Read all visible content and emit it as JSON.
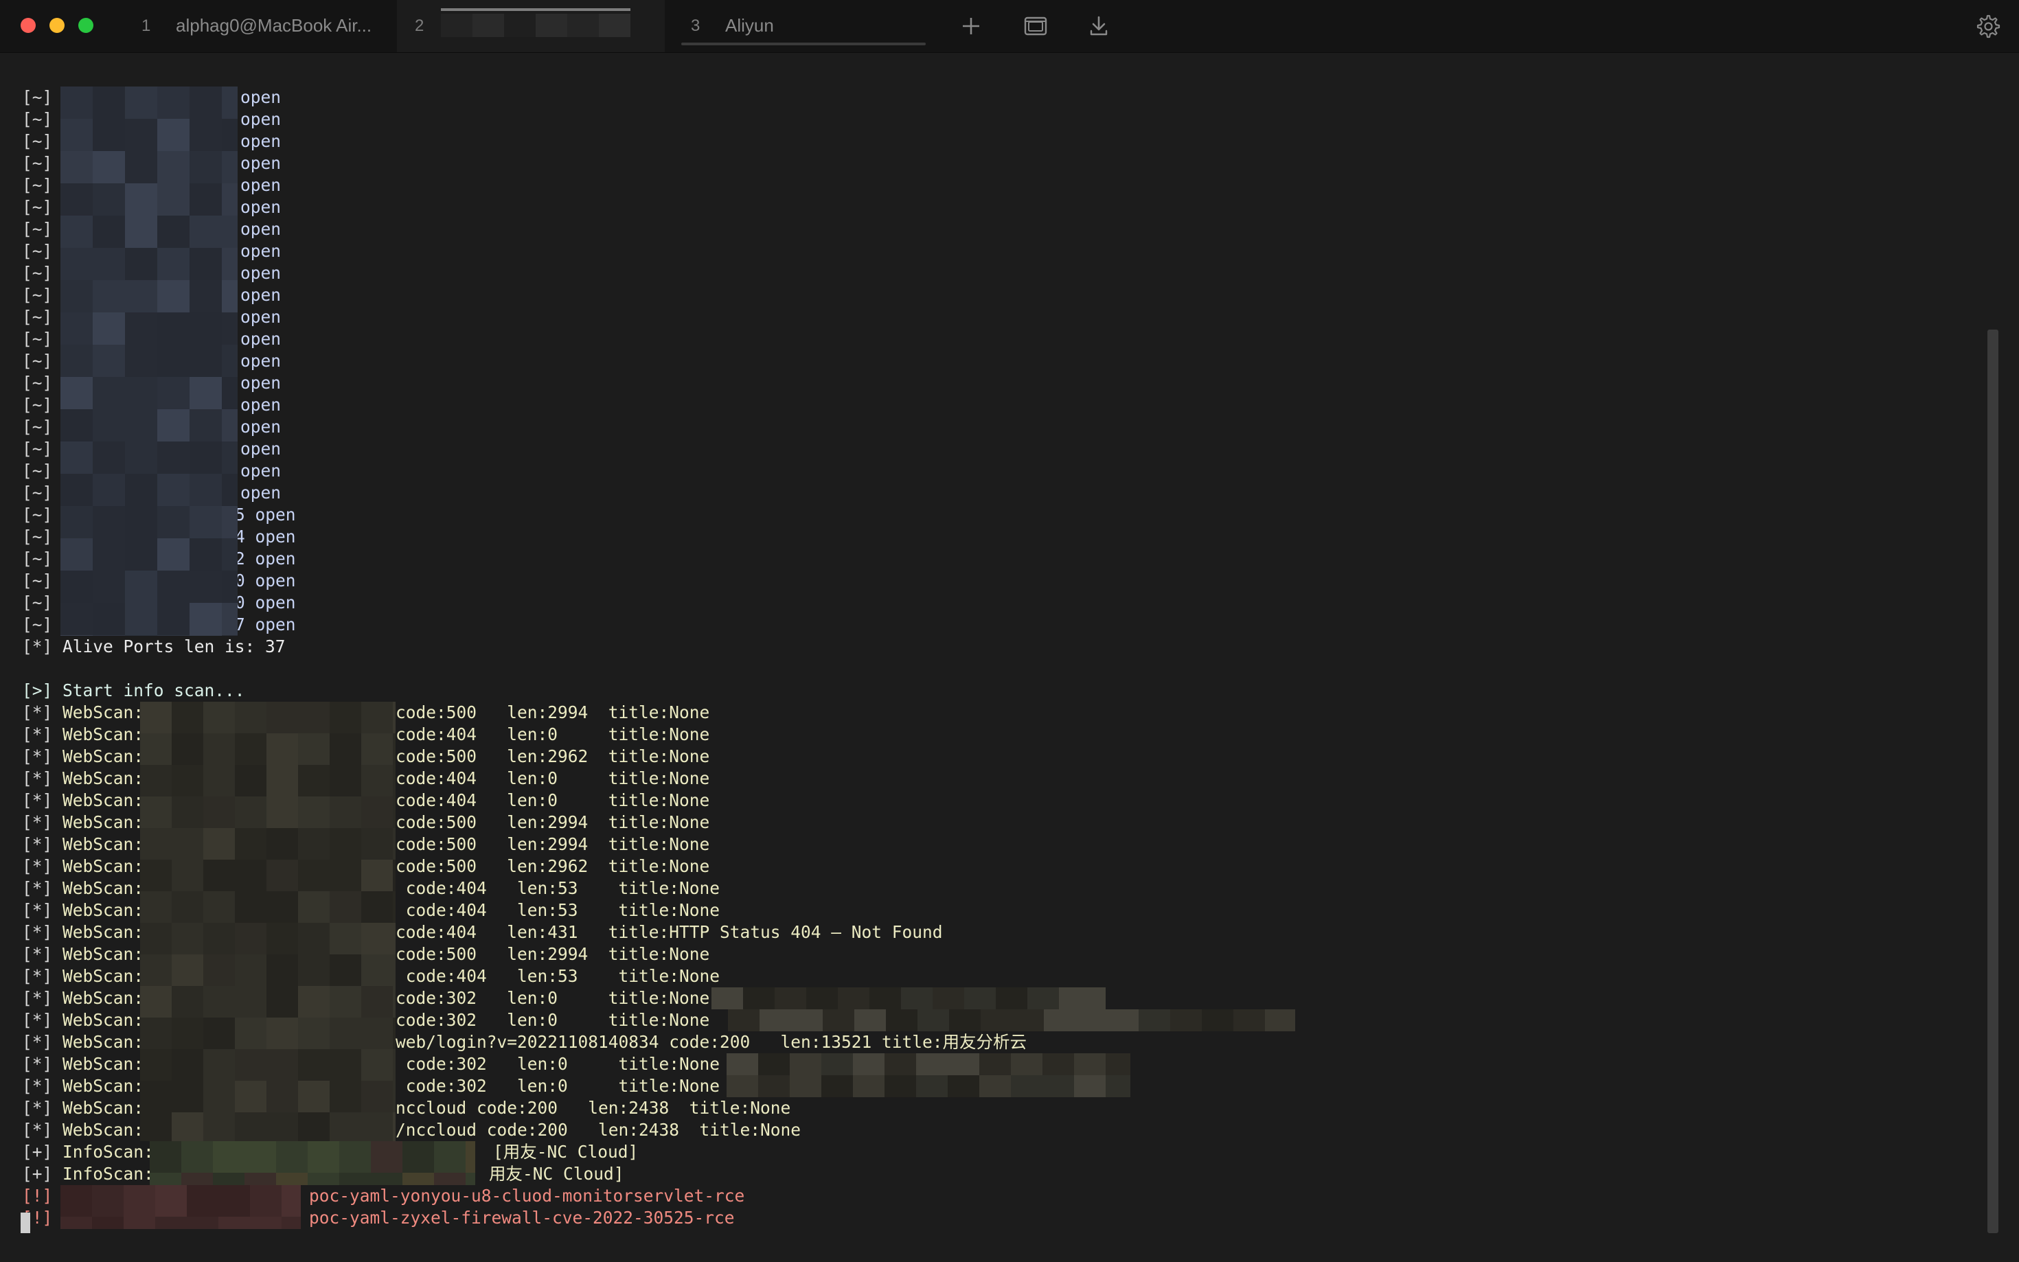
{
  "window": {
    "tabs": [
      {
        "number": "1",
        "title": "alphag0@MacBook Air..."
      },
      {
        "number": "2",
        "title": ""
      },
      {
        "number": "3",
        "title": "Aliyun"
      }
    ],
    "active_tab": 2,
    "icons": {
      "new_tab": "plus-icon",
      "split": "split-pane-icon",
      "download": "download-icon",
      "settings": "gear-icon"
    }
  },
  "colors": {
    "background": "#1c1c1c",
    "tabbar": "#141414",
    "open": "#c8d4f4",
    "web": "#ecebc2",
    "vuln": "#f08a80"
  },
  "terminal": {
    "port_lines": [
      {
        "prefix": "[~]",
        "suffix": "open"
      },
      {
        "prefix": "[~]",
        "suffix": "open"
      },
      {
        "prefix": "[~]",
        "suffix": "open"
      },
      {
        "prefix": "[~]",
        "suffix": "open"
      },
      {
        "prefix": "[~]",
        "suffix": "open"
      },
      {
        "prefix": "[~]",
        "suffix": "open"
      },
      {
        "prefix": "[~]",
        "suffix": "open"
      },
      {
        "prefix": "[~]",
        "suffix": "open"
      },
      {
        "prefix": "[~]",
        "suffix": "open"
      },
      {
        "prefix": "[~]",
        "suffix": "open"
      },
      {
        "prefix": "[~]",
        "suffix": "open"
      },
      {
        "prefix": "[~]",
        "suffix": "open"
      },
      {
        "prefix": "[~]",
        "suffix": "open"
      },
      {
        "prefix": "[~]",
        "suffix": "open"
      },
      {
        "prefix": "[~]",
        "suffix": "open"
      },
      {
        "prefix": "[~]",
        "suffix": "open"
      },
      {
        "prefix": "[~]",
        "suffix": "open"
      },
      {
        "prefix": "[~]",
        "suffix": "open"
      },
      {
        "prefix": "[~]",
        "suffix": "open"
      },
      {
        "prefix": "[~]",
        "suffix": "5 open"
      },
      {
        "prefix": "[~]",
        "suffix": "4 open"
      },
      {
        "prefix": "[~]",
        "suffix": "2 open"
      },
      {
        "prefix": "[~]",
        "suffix": "0 open"
      },
      {
        "prefix": "[~]",
        "suffix": "0 open"
      },
      {
        "prefix": "[~]",
        "suffix": "7 open"
      }
    ],
    "alive_ports": {
      "prefix": "[*]",
      "text": "Alive Ports len is: 37"
    },
    "start_scan": {
      "prefix": "[>]",
      "text": "Start info scan..."
    },
    "webscan_label": "WebScan:",
    "webscan_lines": [
      {
        "prefix": "[*]",
        "text": "code:500   len:2994  title:None"
      },
      {
        "prefix": "[*]",
        "text": "code:404   len:0     title:None"
      },
      {
        "prefix": "[*]",
        "text": "code:500   len:2962  title:None"
      },
      {
        "prefix": "[*]",
        "text": "code:404   len:0     title:None"
      },
      {
        "prefix": "[*]",
        "text": "code:404   len:0     title:None"
      },
      {
        "prefix": "[*]",
        "text": "code:500   len:2994  title:None"
      },
      {
        "prefix": "[*]",
        "text": "code:500   len:2994  title:None"
      },
      {
        "prefix": "[*]",
        "text": "code:500   len:2962  title:None"
      },
      {
        "prefix": "[*]",
        "text": " code:404   len:53    title:None"
      },
      {
        "prefix": "[*]",
        "text": " code:404   len:53    title:None"
      },
      {
        "prefix": "[*]",
        "text": "code:404   len:431   title:HTTP Status 404 – Not Found"
      },
      {
        "prefix": "[*]",
        "text": "code:500   len:2994  title:None"
      },
      {
        "prefix": "[*]",
        "text": " code:404   len:53    title:None"
      },
      {
        "prefix": "[*]",
        "text": "code:302   len:0     title:None"
      },
      {
        "prefix": "[*]",
        "text": "code:302   len:0     title:None"
      },
      {
        "prefix": "[*]",
        "text": "web/login?v=20221108140834 code:200   len:13521 title:用友分析云"
      },
      {
        "prefix": "[*]",
        "text": " code:302   len:0     title:None"
      },
      {
        "prefix": "[*]",
        "text": " code:302   len:0     title:None"
      },
      {
        "prefix": "[*]",
        "text": "nccloud code:200   len:2438  title:None"
      },
      {
        "prefix": "[*]",
        "text": "/nccloud code:200   len:2438  title:None"
      }
    ],
    "infoscan_label": "InfoScan:",
    "infoscan_lines": [
      {
        "prefix": "[+]",
        "text": "[用友-NC Cloud]"
      },
      {
        "prefix": "[+]",
        "text": "用友-NC Cloud]"
      }
    ],
    "vuln_lines": [
      {
        "prefix": "[!]",
        "text": "poc-yaml-yonyou-u8-cluod-monitorservlet-rce"
      },
      {
        "prefix": "[!]",
        "text": "poc-yaml-zyxel-firewall-cve-2022-30525-rce"
      }
    ]
  }
}
